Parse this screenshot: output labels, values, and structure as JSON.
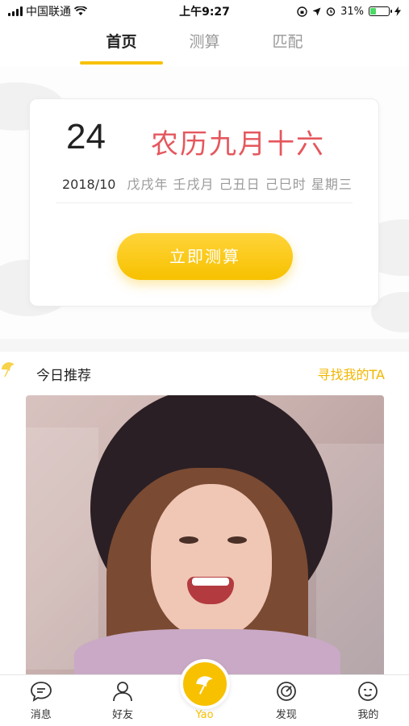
{
  "status_bar": {
    "carrier": "中国联通",
    "time": "上午9:27",
    "battery": "31%",
    "battery_level": 0.31
  },
  "tabs": [
    {
      "label": "首页",
      "active": true
    },
    {
      "label": "测算",
      "active": false
    },
    {
      "label": "匹配",
      "active": false
    }
  ],
  "date_card": {
    "day": "24",
    "lunar": "农历九月十六",
    "year_month": "2018/10",
    "ganzhi": "戊戌年 壬戌月 己丑日 己巳时 星期三",
    "button_label": "立即测算"
  },
  "recommend": {
    "title": "今日推荐",
    "link": "寻找我的TA"
  },
  "bottom_nav": [
    {
      "label": "消息",
      "icon": "message-icon"
    },
    {
      "label": "好友",
      "icon": "friends-icon"
    },
    {
      "label": "Yao",
      "icon": "ginkgo-icon"
    },
    {
      "label": "发现",
      "icon": "discover-icon"
    },
    {
      "label": "我的",
      "icon": "profile-icon"
    }
  ],
  "colors": {
    "accent": "#f7c100",
    "lunar_red": "#e5575d"
  }
}
